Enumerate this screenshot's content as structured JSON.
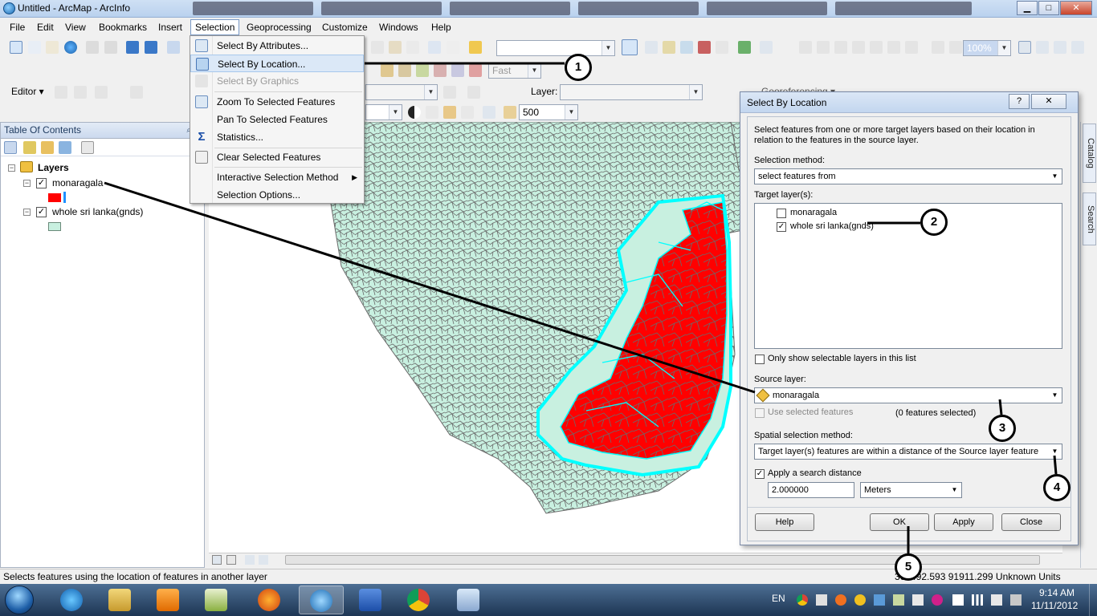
{
  "window": {
    "title": "Untitled - ArcMap - ArcInfo",
    "buttons": {
      "minimize": "▁",
      "maximize": "□",
      "close": "✕"
    }
  },
  "menubar": [
    "File",
    "Edit",
    "View",
    "Bookmarks",
    "Insert",
    "Selection",
    "Geoprocessing",
    "Customize",
    "Windows",
    "Help"
  ],
  "toolbar": {
    "editor_label": "Editor ▾",
    "fast_combo": "Fast",
    "layer_label": "Layer:",
    "scale_value": "500",
    "zoom_combo": "100%",
    "georef_label": "Georeferencing ▾",
    "georef_layer": "Layer:"
  },
  "toc": {
    "title": "Table Of Contents",
    "pin": "⌕",
    "close": "×",
    "root": "Layers",
    "layers": [
      {
        "name": "monaragala",
        "checked": "✓",
        "expand": "−",
        "swatch": "#ff0000"
      },
      {
        "name": "whole sri lanka(gnds)",
        "checked": "✓",
        "expand": "−",
        "swatch": "#c8f0e0"
      }
    ]
  },
  "selection_menu": {
    "items": [
      {
        "label": "Select By Attributes...",
        "icon": "table-select-icon",
        "state": "normal"
      },
      {
        "label": "Select By Location...",
        "icon": "location-select-icon",
        "state": "highlighted"
      },
      {
        "label": "Select By Graphics",
        "icon": "graphics-select-icon",
        "state": "disabled"
      },
      {
        "label": "Zoom To Selected Features",
        "icon": "zoom-selected-icon",
        "state": "normal"
      },
      {
        "label": "Pan To Selected Features",
        "icon": "",
        "state": "normal"
      },
      {
        "label": "Statistics...",
        "icon": "sigma-icon",
        "state": "normal"
      },
      {
        "label": "Clear Selected Features",
        "icon": "clear-selection-icon",
        "state": "normal"
      },
      {
        "label": "Interactive Selection Method",
        "icon": "",
        "state": "submenu"
      },
      {
        "label": "Selection Options...",
        "icon": "",
        "state": "normal"
      }
    ],
    "submenu_arrow": "▶"
  },
  "dialog": {
    "title": "Select By Location",
    "help_glyph": "?",
    "close_glyph": "✕",
    "description": "Select features from one or more target layers based on their location in relation to the features in the source layer.",
    "selection_method_label": "Selection method:",
    "selection_method_value": "select features from",
    "target_layers_label": "Target layer(s):",
    "target_layers": [
      {
        "name": "monaragala",
        "checked": ""
      },
      {
        "name": "whole sri lanka(gnds)",
        "checked": "✓"
      }
    ],
    "only_selectable_label": "Only show selectable layers in this list",
    "source_layer_label": "Source layer:",
    "source_layer_value": "monaragala",
    "use_selected_label": "Use selected features",
    "features_selected": "(0 features selected)",
    "spatial_method_label": "Spatial selection method:",
    "spatial_method_value": "Target layer(s) features are within a distance of the Source layer feature",
    "apply_distance_label": "Apply a search distance",
    "apply_distance_checked": "✓",
    "distance_value": "2.000000",
    "units_value": "Meters",
    "buttons": {
      "help": "Help",
      "ok": "OK",
      "apply": "Apply",
      "close": "Close"
    }
  },
  "right_dock": {
    "catalog": "Catalog",
    "search": "Search"
  },
  "statusbar": {
    "message": "Selects features using the location of features in another layer",
    "coords": "360492.593  91911.299 Unknown Units"
  },
  "taskbar": {
    "language": "EN",
    "time": "9:14 AM",
    "date": "11/11/2012"
  },
  "callouts": [
    "1",
    "2",
    "3",
    "4",
    "5"
  ],
  "colors": {
    "selected_fill": "#ff0000",
    "selected_outline": "#00ffff",
    "basemap_fill": "#c8f0e0",
    "basemap_lines": "#6a6a6a"
  }
}
